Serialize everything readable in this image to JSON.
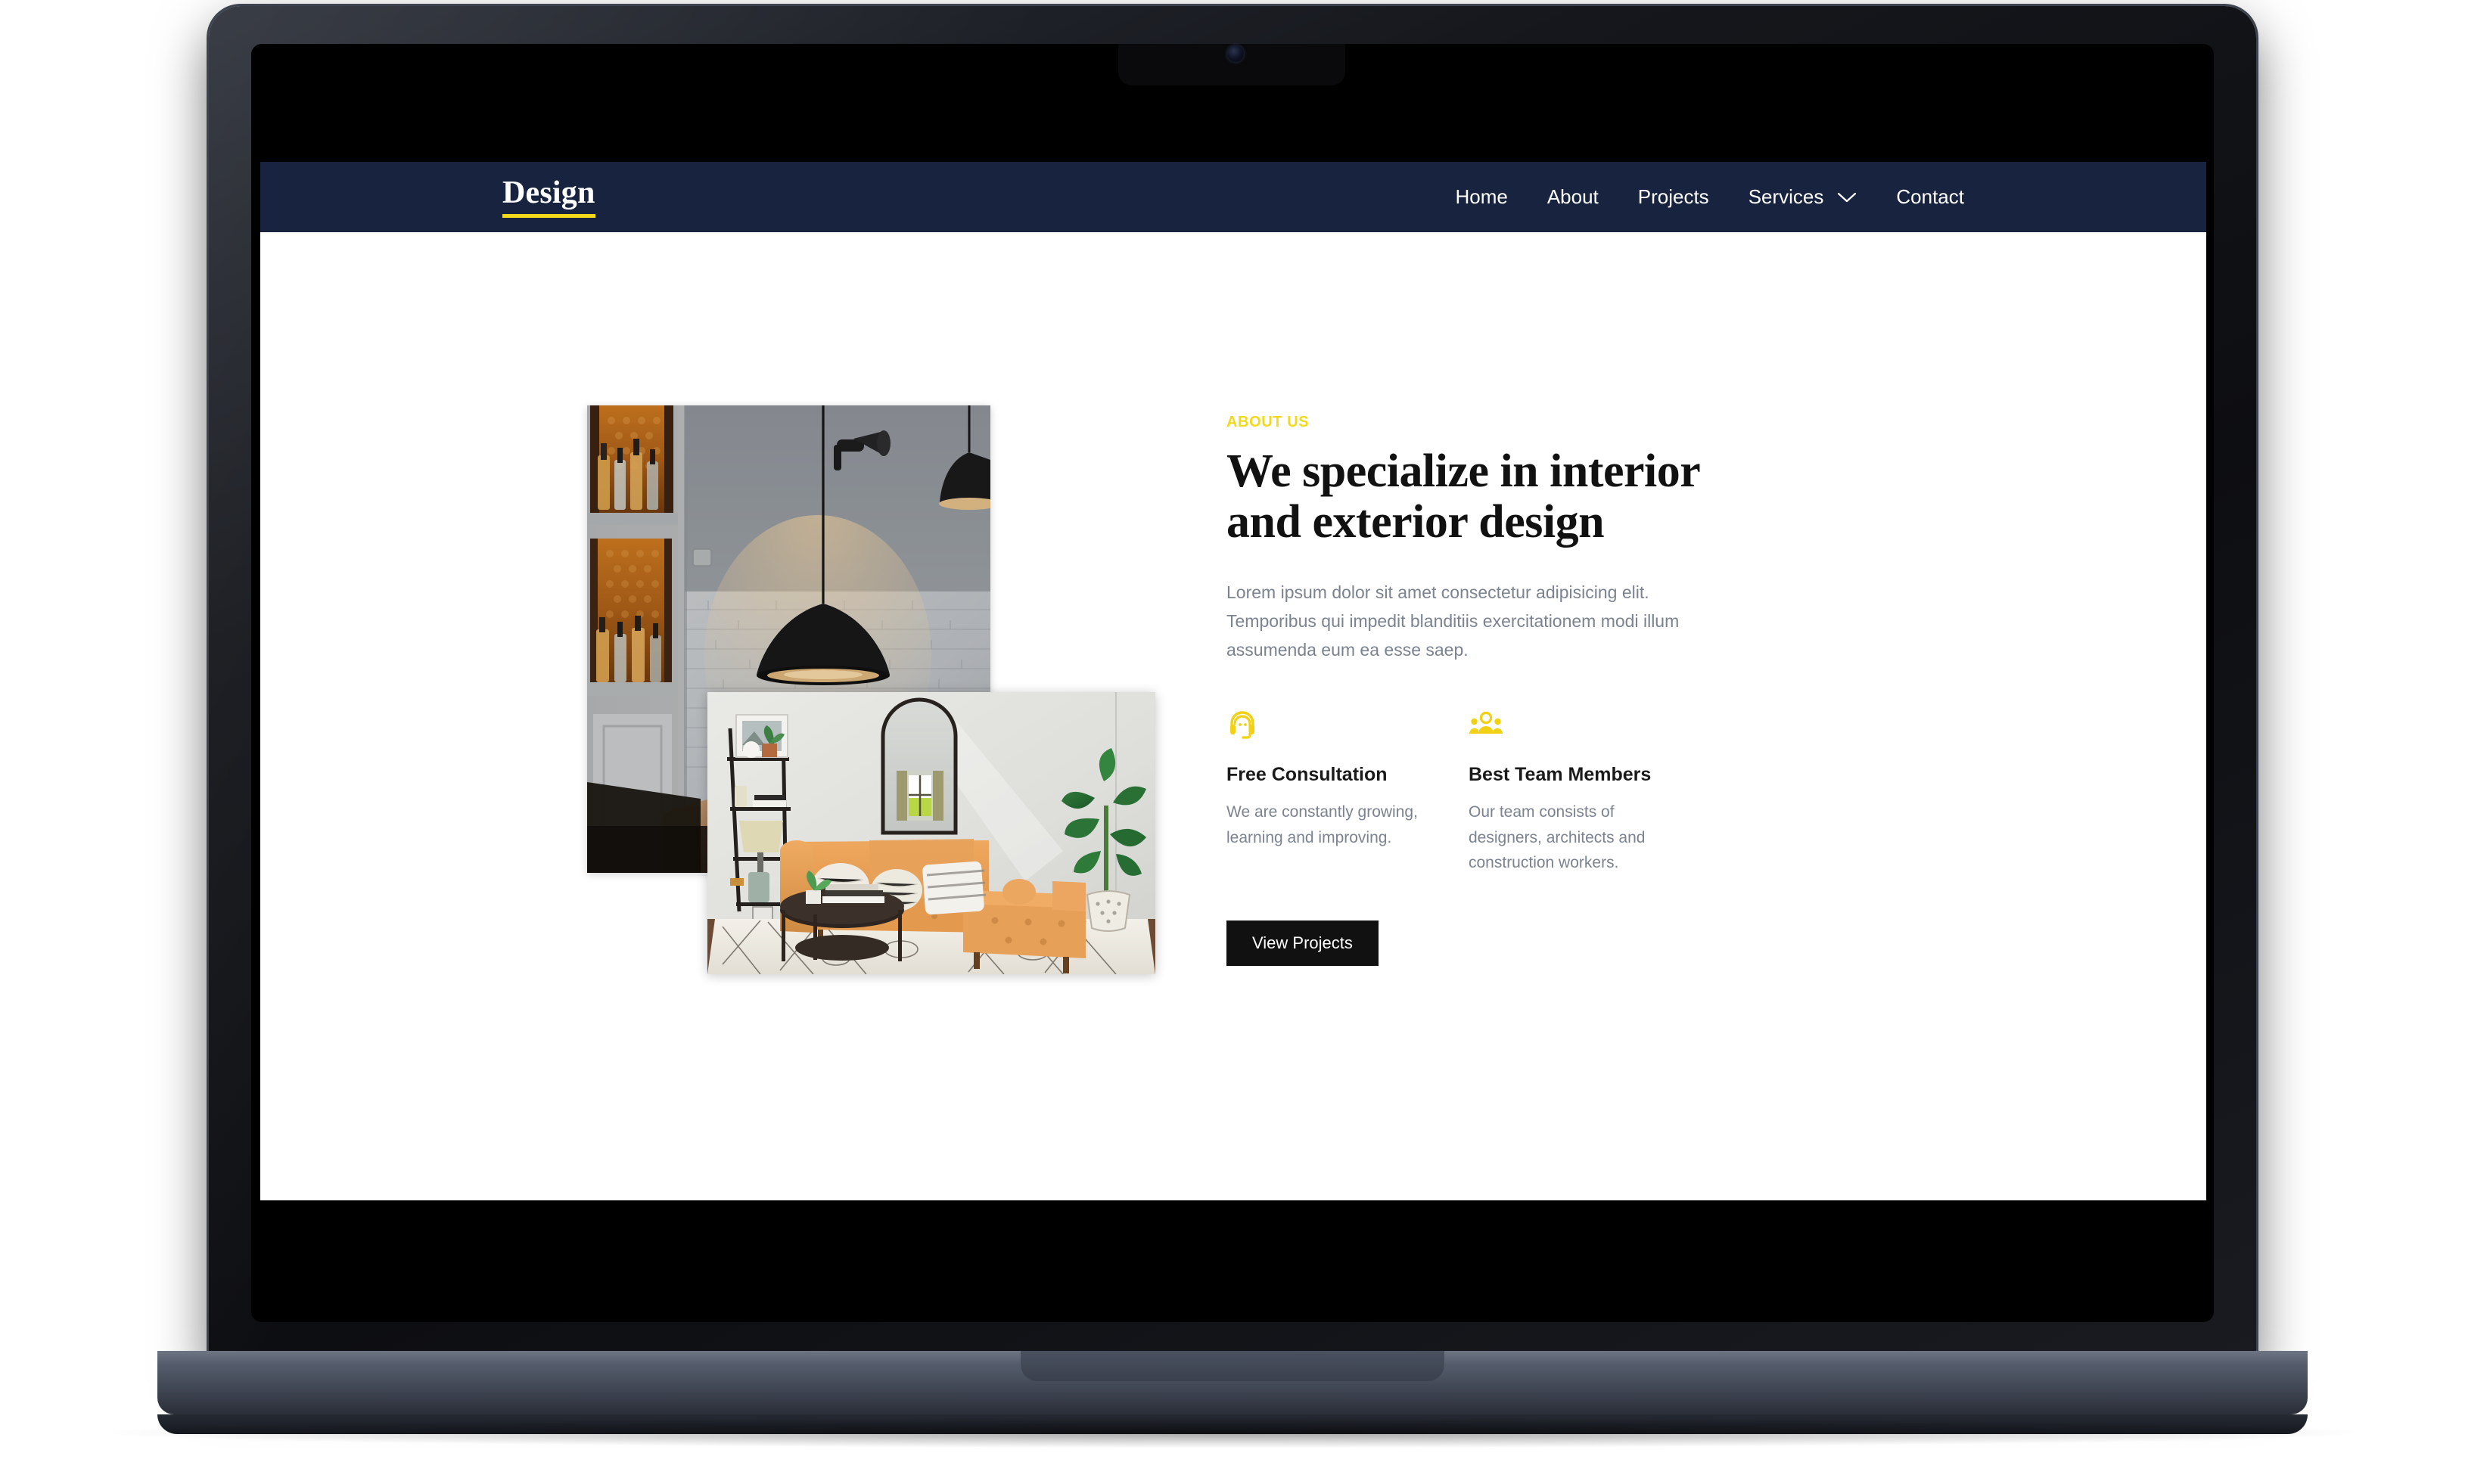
{
  "site": {
    "brand": "Design"
  },
  "nav": {
    "items": [
      {
        "label": "Home",
        "has_caret": false
      },
      {
        "label": "About",
        "has_caret": false
      },
      {
        "label": "Projects",
        "has_caret": false
      },
      {
        "label": "Services",
        "has_caret": true
      },
      {
        "label": "Contact",
        "has_caret": false
      }
    ],
    "caret_icon": "chevron-down-icon",
    "background_color": "#18243f",
    "link_color": "#ffffff",
    "brand_underline_color": "#f2d91c"
  },
  "about": {
    "eyebrow": "ABOUT US",
    "eyebrow_color": "#f2d91c",
    "headline": "We specialize in interior and exterior design",
    "paragraph": "Lorem ipsum dolor sit amet consectetur adipisicing elit. Temporibus qui impedit blanditiis exercitationem modi illum assumenda eum ea esse saep.",
    "features": [
      {
        "icon": "headset-support-icon",
        "title": "Free Consultation",
        "description": "We are constantly growing, learning and improving."
      },
      {
        "icon": "people-group-icon",
        "title": "Best Team Members",
        "description": "Our team consists of designers, architects and construction workers."
      }
    ],
    "cta_label": "View Projects",
    "cta_background": "#111111",
    "icon_color": "#f2d014"
  },
  "media": {
    "decorative_stripes": "diagonal-yellow-stripes",
    "stripe_color": "#fdf3ad",
    "photos": [
      {
        "name": "lounge-bar-interior-photo",
        "alt": "Dark bar lounge interior with black pendant lamps, backlit bottle cabinet and tufted leather sofa"
      },
      {
        "name": "living-room-interior-photo",
        "alt": "Bright living room with tan leather sectional sofa, arched mirror, ladder shelf, plant and patterned rug"
      }
    ]
  },
  "device": {
    "type": "laptop-mockup",
    "camera": "webcam-dot"
  }
}
